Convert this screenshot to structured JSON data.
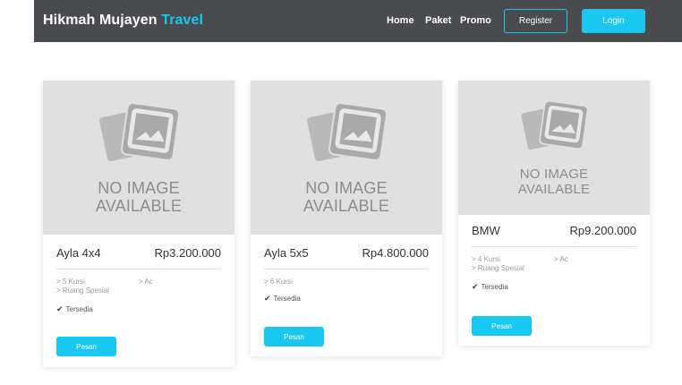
{
  "navbar": {
    "brand_main": "Hikmah Mujayen",
    "brand_accent": "Travel",
    "links": [
      "Home",
      "Paket",
      "Promo"
    ],
    "register_label": "Register",
    "login_label": "Login"
  },
  "placeholder": {
    "line1": "NO IMAGE",
    "line2": "AVAILABLE"
  },
  "cards": [
    {
      "name": "Ayla 4x4",
      "price": "Rp3.200.000",
      "features_left": [
        "> 5 Kursi",
        "> Ruang Spesial"
      ],
      "features_right": [
        "> Ac"
      ],
      "status": "Tersedia",
      "button": "Pesan"
    },
    {
      "name": "Ayla 5x5",
      "price": "Rp4.800.000",
      "features_left": [
        "> 6 Kursi"
      ],
      "features_right": [],
      "status": "Tersedia",
      "button": "Pesan"
    },
    {
      "name": "BMW",
      "price": "Rp9.200.000",
      "features_left": [
        "> 4 Kursi",
        "> Ruang Spesial"
      ],
      "features_right": [
        "> Ac"
      ],
      "status": "Tersedia",
      "button": "Pesan"
    }
  ],
  "colors": {
    "accent": "#19c8f0",
    "navbar": "#4a4b4e",
    "placeholder_bg": "#e0e0e0"
  }
}
